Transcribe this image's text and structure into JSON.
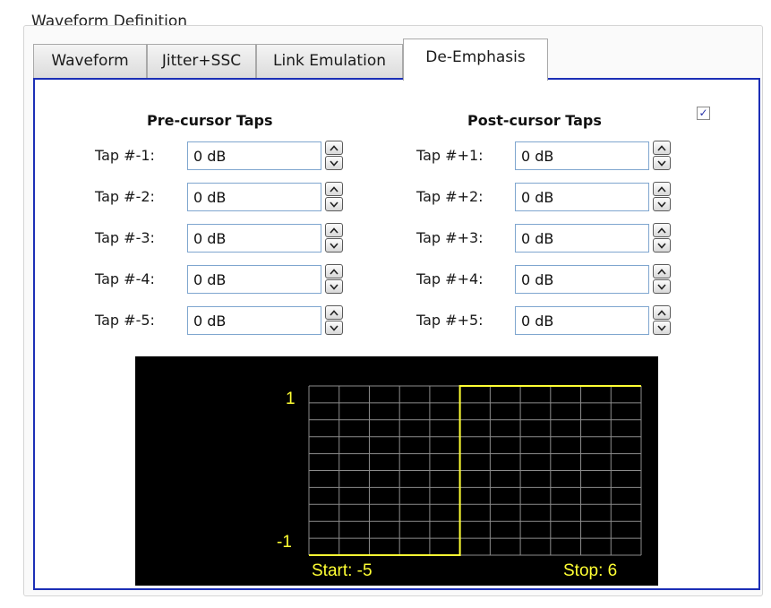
{
  "group_title": "Waveform Definition",
  "tabs": [
    {
      "label": "Waveform",
      "active": false
    },
    {
      "label": "Jitter+SSC",
      "active": false
    },
    {
      "label": "Link Emulation",
      "active": false
    },
    {
      "label": "De-Emphasis",
      "active": true
    }
  ],
  "enable_checkbox": {
    "checked": true
  },
  "pre_cursor": {
    "header": "Pre-cursor Taps",
    "taps": [
      {
        "label": "Tap #-1:",
        "value": "0 dB"
      },
      {
        "label": "Tap #-2:",
        "value": "0 dB"
      },
      {
        "label": "Tap #-3:",
        "value": "0 dB"
      },
      {
        "label": "Tap #-4:",
        "value": "0 dB"
      },
      {
        "label": "Tap #-5:",
        "value": "0 dB"
      }
    ]
  },
  "post_cursor": {
    "header": "Post-cursor Taps",
    "taps": [
      {
        "label": "Tap #+1:",
        "value": "0 dB"
      },
      {
        "label": "Tap #+2:",
        "value": "0 dB"
      },
      {
        "label": "Tap #+3:",
        "value": "0 dB"
      },
      {
        "label": "Tap #+4:",
        "value": "0 dB"
      },
      {
        "label": "Tap #+5:",
        "value": "0 dB"
      }
    ]
  },
  "preview": {
    "y_max_label": "1",
    "y_min_label": "-1",
    "start_label": "Start: -5",
    "stop_label": "Stop: 6",
    "trace_color": "#ffff33",
    "grid_color": "#8c8c8c",
    "x_range": [
      -5,
      6
    ],
    "y_range": [
      -1,
      1
    ],
    "waveform": [
      [
        -5,
        -1
      ],
      [
        0,
        -1
      ],
      [
        0,
        1
      ],
      [
        6,
        1
      ]
    ]
  }
}
